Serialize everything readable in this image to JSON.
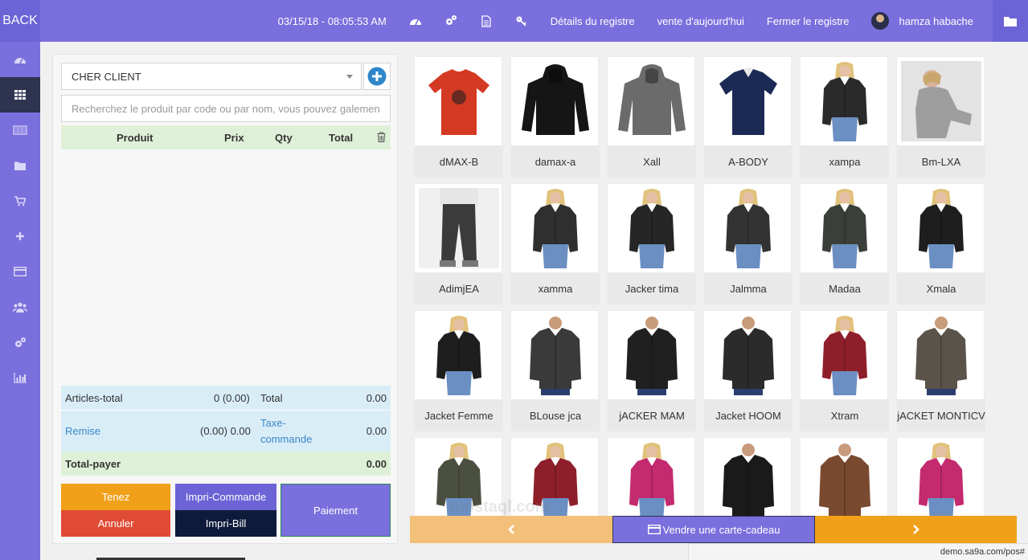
{
  "topbar": {
    "back_label": "BACK",
    "datetime": "03/15/18 - 08:05:53 AM",
    "icons": [
      "dashboard-icon",
      "cogs-icon",
      "document-icon",
      "key-icon"
    ],
    "register_details": "Détails du registre",
    "today_sale": "vente d'aujourd'hui",
    "close_register": "Fermer le registre",
    "user_name": "hamza habache"
  },
  "sidebar": {
    "items": [
      {
        "icon": "dashboard-icon"
      },
      {
        "icon": "grid-icon",
        "active": true
      },
      {
        "icon": "barcode-icon"
      },
      {
        "icon": "folder-icon"
      },
      {
        "icon": "cart-icon"
      },
      {
        "icon": "plus-icon"
      },
      {
        "icon": "credit-card-icon"
      },
      {
        "icon": "users-icon"
      },
      {
        "icon": "cogs-icon"
      },
      {
        "icon": "bar-chart-icon"
      }
    ]
  },
  "cart": {
    "client": "CHER CLIENT",
    "search_placeholder": "Recherchez le produit par code ou par nom, vous pouvez galement scanner le code",
    "columns": {
      "product": "Produit",
      "price": "Prix",
      "qty": "Qty",
      "total": "Total"
    },
    "summary": {
      "articles_label": "Articles-total",
      "articles_value": "0 (0.00)",
      "total_label": "Total",
      "total_value": "0.00",
      "discount_label": "Remise",
      "discount_value": "(0.00) 0.00",
      "tax_label_1": "Taxe-",
      "tax_label_2": "commande",
      "tax_value": "0.00",
      "grand_label": "Total-payer",
      "grand_value": "0.00"
    },
    "buttons": {
      "hold": "Tenez",
      "cancel": "Annuler",
      "print_order": "Impri-Commande",
      "print_bill": "Impri-Bill",
      "payment": "Paiement"
    }
  },
  "products": [
    {
      "name": "dMAX-B",
      "kind": "tshirt",
      "color": "#d43a22"
    },
    {
      "name": "damax-a",
      "kind": "hoodie",
      "color": "#151515"
    },
    {
      "name": "Xall",
      "kind": "hoodie",
      "color": "#6b6b6b"
    },
    {
      "name": "A-BODY",
      "kind": "polo",
      "color": "#1b2a55"
    },
    {
      "name": "xampa",
      "kind": "woman",
      "color": "#2a2a2a"
    },
    {
      "name": "Bm-LXA",
      "kind": "sweater",
      "color": "#9e9e9e"
    },
    {
      "name": "AdimjEA",
      "kind": "jeans",
      "color": "#3b3b3b"
    },
    {
      "name": "xamma",
      "kind": "woman",
      "color": "#2f2f2f"
    },
    {
      "name": "Jacker tima",
      "kind": "woman",
      "color": "#262626"
    },
    {
      "name": "Jalmma",
      "kind": "woman",
      "color": "#333333"
    },
    {
      "name": "Madaa",
      "kind": "woman",
      "color": "#3a3f3a"
    },
    {
      "name": "Xmala",
      "kind": "woman",
      "color": "#1e1e1e"
    },
    {
      "name": "Jacket Femme",
      "kind": "woman",
      "color": "#1e1e1e"
    },
    {
      "name": "BLouse jca",
      "kind": "man",
      "color": "#3a3a3a"
    },
    {
      "name": "jACKER MAM",
      "kind": "man",
      "color": "#202020"
    },
    {
      "name": "Jacket HOOM",
      "kind": "man",
      "color": "#2b2b2b"
    },
    {
      "name": "Xtram",
      "kind": "woman",
      "color": "#8e1f2a"
    },
    {
      "name": "jACKET MONTICV",
      "kind": "man",
      "color": "#5a534a"
    },
    {
      "name": "",
      "kind": "woman",
      "color": "#4b4f40"
    },
    {
      "name": "",
      "kind": "woman",
      "color": "#8e1f2a"
    },
    {
      "name": "",
      "kind": "woman",
      "color": "#c42a6e"
    },
    {
      "name": "",
      "kind": "man",
      "color": "#1a1a1a"
    },
    {
      "name": "",
      "kind": "man",
      "color": "#7a4a30"
    },
    {
      "name": "",
      "kind": "woman",
      "color": "#c42a6e"
    }
  ],
  "pager": {
    "gift_card": "Vendre une carte-cadeau"
  },
  "status_url": "demo.sa9a.com/pos#",
  "watermark": "mostaql.com",
  "colors": {
    "primary": "#7a6fdc",
    "dark": "#2e3350",
    "hold": "#f1a019",
    "cancel": "#e04b35",
    "print_order": "#6c63d6",
    "print_bill": "#0d1a3a",
    "payment": "#7a6fdc"
  }
}
